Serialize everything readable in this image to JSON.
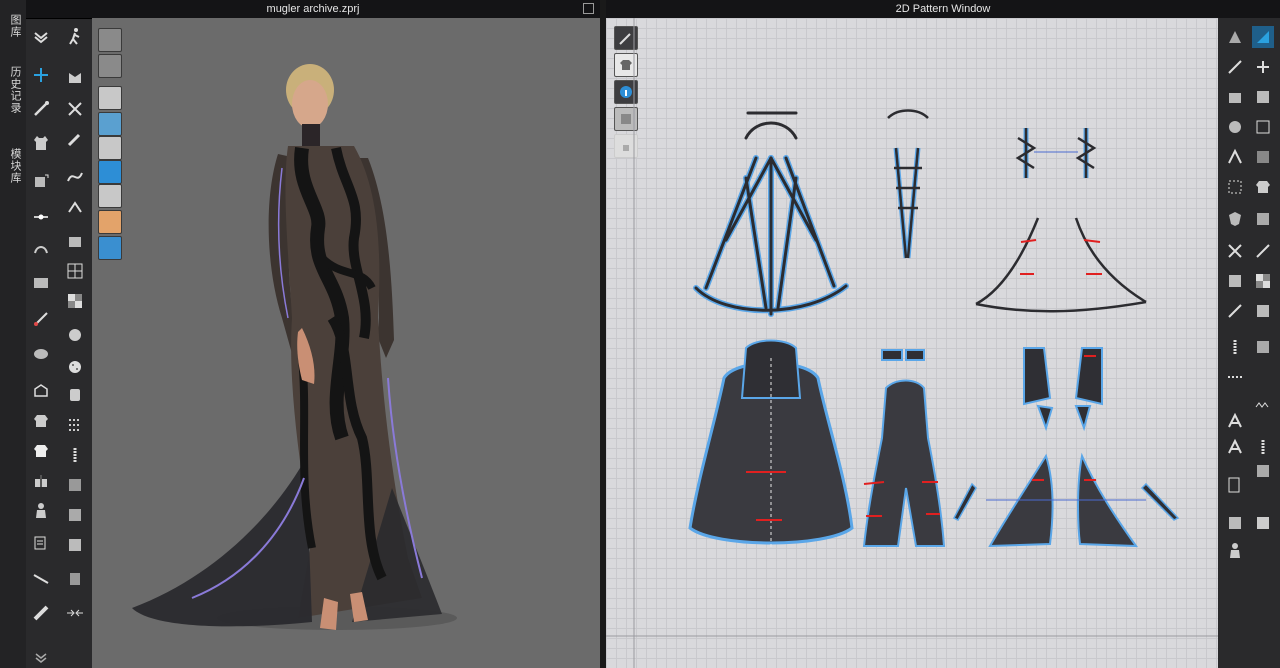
{
  "sidebar": {
    "tabs": [
      {
        "label": "图库"
      },
      {
        "label": "历史记录"
      },
      {
        "label": "模块库"
      }
    ]
  },
  "viewport3d": {
    "title": "mugler archive.zprj"
  },
  "pattern_window": {
    "title": "2D Pattern Window"
  },
  "colors": {
    "accent": "#2aa1e0",
    "seam_line": "#5aa6e8",
    "measure_red": "#e02020",
    "garment_dark": "#2a2a2e",
    "grid_bg": "#d9d9dc"
  }
}
